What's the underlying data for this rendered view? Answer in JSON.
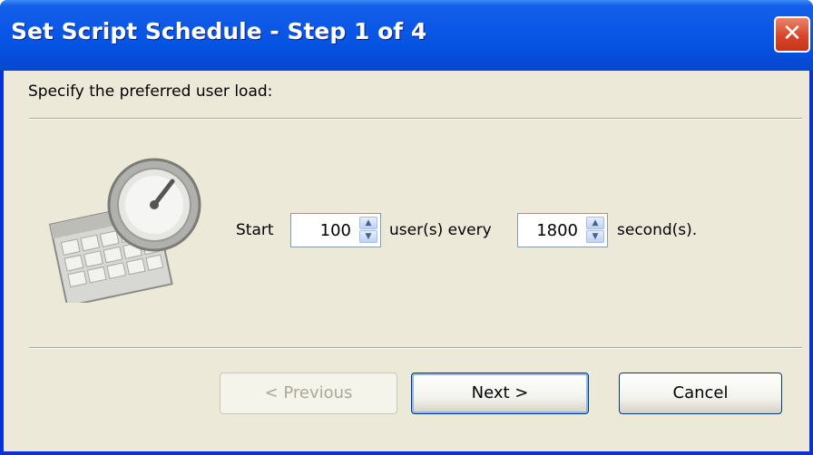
{
  "window": {
    "title": "Set Script Schedule - Step 1 of 4",
    "close_glyph": "✕"
  },
  "content": {
    "prompt": "Specify the preferred user load:",
    "start_label": "Start",
    "users_value": "100",
    "users_unit_label": "user(s) every",
    "seconds_value": "1800",
    "seconds_unit_label": "second(s)."
  },
  "buttons": {
    "previous": "< Previous",
    "next": "Next >",
    "cancel": "Cancel"
  },
  "icons": {
    "illustration": "stopwatch-calendar-icon",
    "spin_up": "chevron-up-icon",
    "spin_down": "chevron-down-icon"
  }
}
